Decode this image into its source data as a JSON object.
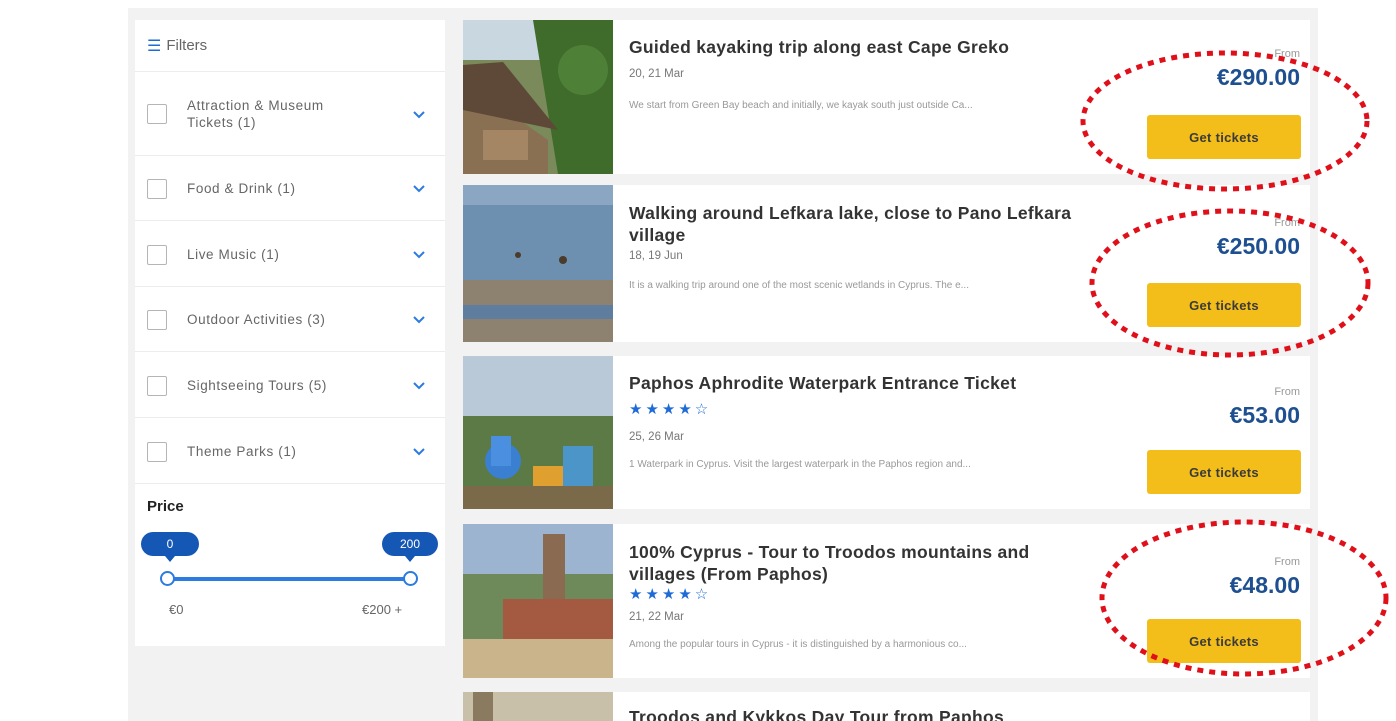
{
  "sidebar": {
    "filters_title": "Filters",
    "categories": [
      {
        "label_line1": "Attraction & Museum",
        "label_line2": "Tickets (1)"
      },
      {
        "label_line1": "Food & Drink (1)"
      },
      {
        "label_line1": "Live Music (1)"
      },
      {
        "label_line1": "Outdoor Activities (3)"
      },
      {
        "label_line1": "Sightseeing Tours (5)"
      },
      {
        "label_line1": "Theme Parks (1)"
      }
    ],
    "price": {
      "title": "Price",
      "min_bubble": "0",
      "max_bubble": "200",
      "min_label": "€0",
      "max_label": "€200 +"
    }
  },
  "listings": [
    {
      "title_line1": "Guided kayaking trip along east Cape Greko",
      "title_line2": "",
      "dates": "20, 21 Mar",
      "description": "We start from Green Bay beach and initially, we kayak south just outside Ca...",
      "from_label": "From",
      "price": "€290.00",
      "button": "Get tickets"
    },
    {
      "title_line1": "Walking around Lefkara lake, close to Pano Lefkara",
      "title_line2": "village",
      "dates": "18, 19 Jun",
      "description": "It is a walking trip around one of the most scenic wetlands in Cyprus. The e...",
      "from_label": "From",
      "price": "€250.00",
      "button": "Get tickets"
    },
    {
      "title_line1": "Paphos Aphrodite Waterpark Entrance Ticket",
      "title_line2": "",
      "stars": "★★★★☆",
      "rating": 4.5,
      "dates": "25, 26 Mar",
      "description": "1 Waterpark in Cyprus. Visit the largest waterpark in the Paphos region and...",
      "from_label": "From",
      "price": "€53.00",
      "button": "Get tickets"
    },
    {
      "title_line1": "100% Cyprus - Tour to Troodos mountains and",
      "title_line2": "villages (From Paphos)",
      "stars": "★★★★☆",
      "rating": 4.5,
      "dates": "21, 22 Mar",
      "description": "Among the popular tours in Cyprus - it is distinguished by a harmonious co...",
      "from_label": "From",
      "price": "€48.00",
      "button": "Get tickets"
    },
    {
      "title_line1": "Troodos and Kykkos Day Tour from Paphos"
    }
  ],
  "colors": {
    "accent": "#1e6bd6",
    "price": "#1d4f91",
    "button": "#f3bd1a",
    "annotation": "#e0101a"
  }
}
